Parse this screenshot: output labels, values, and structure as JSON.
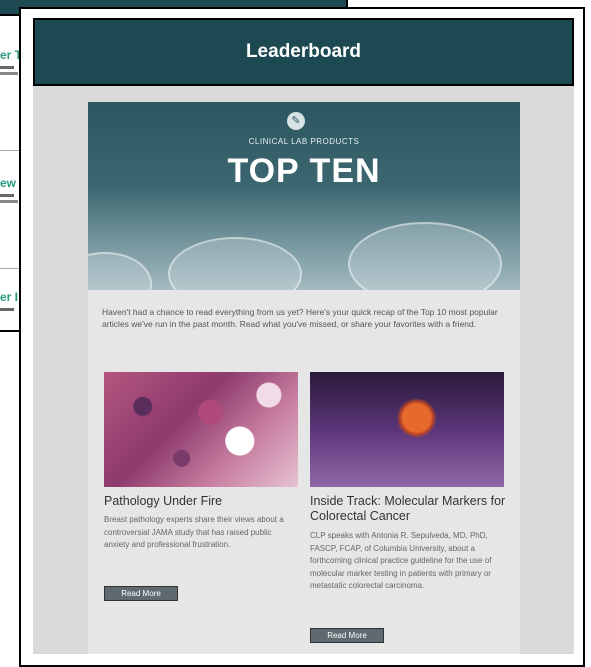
{
  "header": {
    "title": "Leaderboard"
  },
  "background_page": {
    "items": [
      {
        "title": "er T"
      },
      {
        "title": "ew"
      },
      {
        "title": "er I"
      }
    ]
  },
  "email": {
    "brand": "CLINICAL LAB PRODUCTS",
    "headline": "TOP TEN",
    "intro": "Haven't had a chance to read everything from us yet? Here's your quick recap of the Top 10 most popular articles we've run in the past month. Read what you've missed, or share your favorites with a friend.",
    "articles": [
      {
        "title": "Pathology Under Fire",
        "body": "Breast pathology experts share their views about a controversial JAMA study that has raised public anxiety and professional frustration.",
        "button": "Read More"
      },
      {
        "title": "Inside Track: Molecular Markers for Colorectal Cancer",
        "body": "CLP speaks with Antonia R. Sepulveda, MD, PhD, FASCP, FCAP, of Columbia University, about a forthcoming clinical practice guideline for the use of molecular marker testing in patients with primary or metastatic colorectal carcinoma.",
        "button": "Read More"
      }
    ]
  }
}
